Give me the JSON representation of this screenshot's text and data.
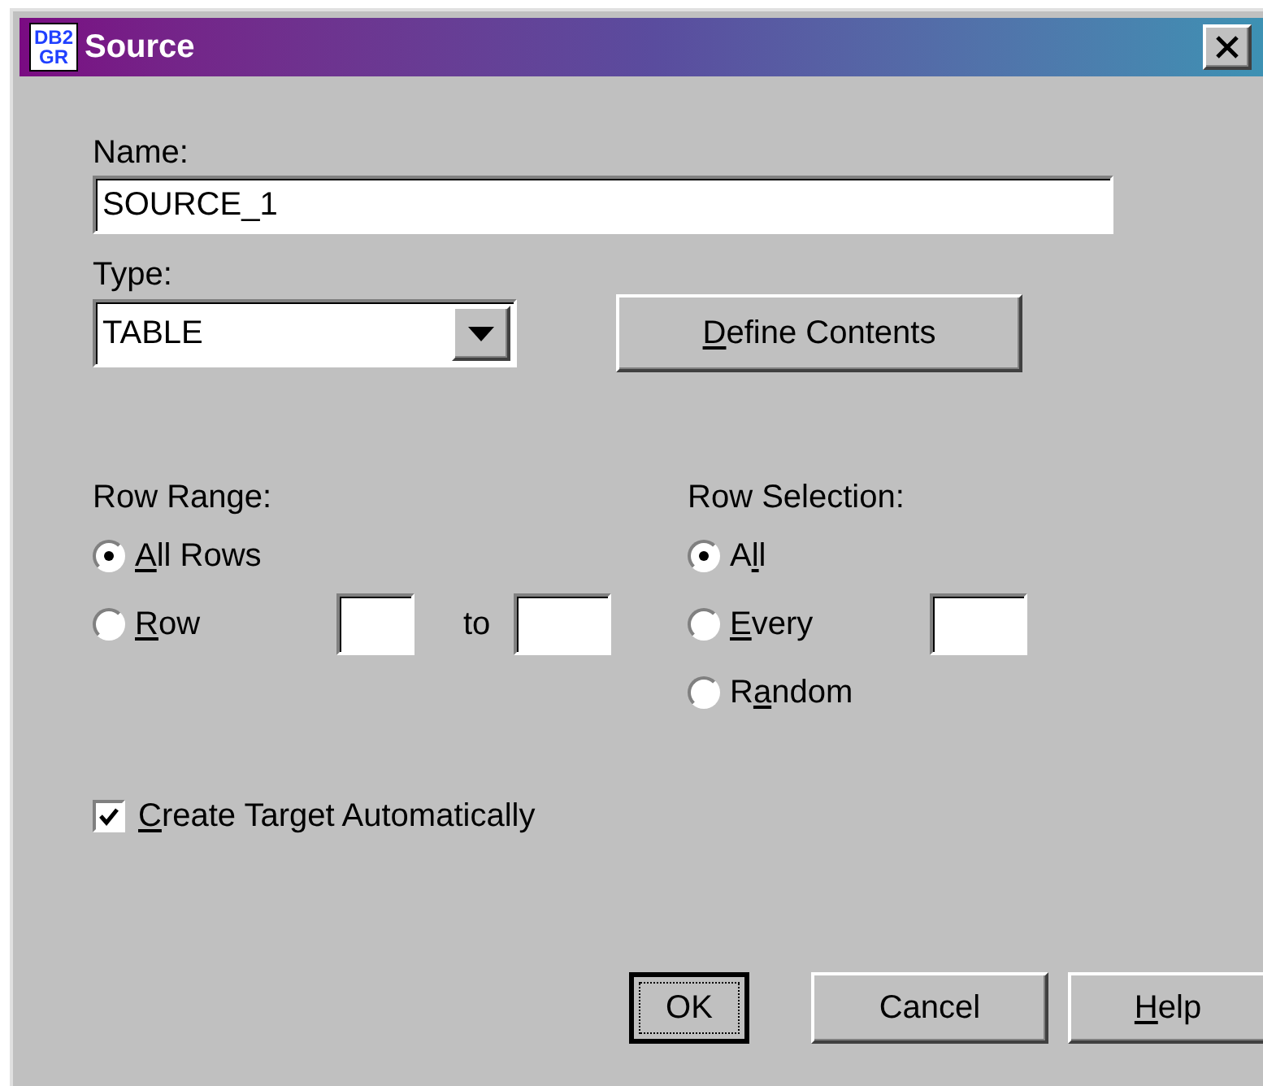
{
  "window": {
    "title": "Source",
    "icon_text": [
      "DB2",
      "GR"
    ]
  },
  "name_field": {
    "label": "Name:",
    "value": "SOURCE_1"
  },
  "type_field": {
    "label": "Type:",
    "value": "TABLE"
  },
  "define_button": {
    "key": "D",
    "post": "efine Contents"
  },
  "row_range": {
    "label": "Row Range:",
    "options": [
      {
        "key": "A",
        "post": "ll Rows",
        "selected": true
      },
      {
        "key": "R",
        "post": "ow",
        "selected": false
      }
    ],
    "to_label": "to"
  },
  "row_selection": {
    "label": "Row Selection:",
    "options": [
      {
        "pre": "A",
        "key": "l",
        "post": "l",
        "selected": true
      },
      {
        "key": "E",
        "post": "very",
        "selected": false
      },
      {
        "pre": "R",
        "key": "a",
        "post": "ndom",
        "selected": false
      }
    ]
  },
  "create_target": {
    "key": "C",
    "post": "reate Target Automatically",
    "checked": true
  },
  "buttons": [
    {
      "pre": "OK",
      "default": true
    },
    {
      "pre": "Cancel",
      "default": false
    },
    {
      "key": "H",
      "post": "elp",
      "default": false
    }
  ]
}
